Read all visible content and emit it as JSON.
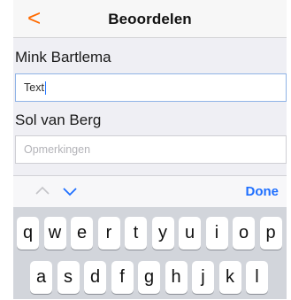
{
  "navbar": {
    "back_glyph": "<",
    "title": "Beoordelen"
  },
  "form": [
    {
      "label": "Mink Bartlema",
      "value": "Text",
      "placeholder": ""
    },
    {
      "label": "Sol van Berg",
      "value": "",
      "placeholder": "Opmerkingen"
    }
  ],
  "accessory": {
    "prev_icon": "chevron-up-icon",
    "next_icon": "chevron-down-icon",
    "done_label": "Done"
  },
  "keyboard": {
    "row1": [
      "q",
      "w",
      "e",
      "r",
      "t",
      "y",
      "u",
      "i",
      "o",
      "p"
    ],
    "row2": [
      "a",
      "s",
      "d",
      "f",
      "g",
      "h",
      "j",
      "k",
      "l"
    ]
  },
  "colors": {
    "accent": "#ff6a00",
    "link": "#1e6fff",
    "background": "#efeff4",
    "keyboard": "#d2d5db"
  }
}
